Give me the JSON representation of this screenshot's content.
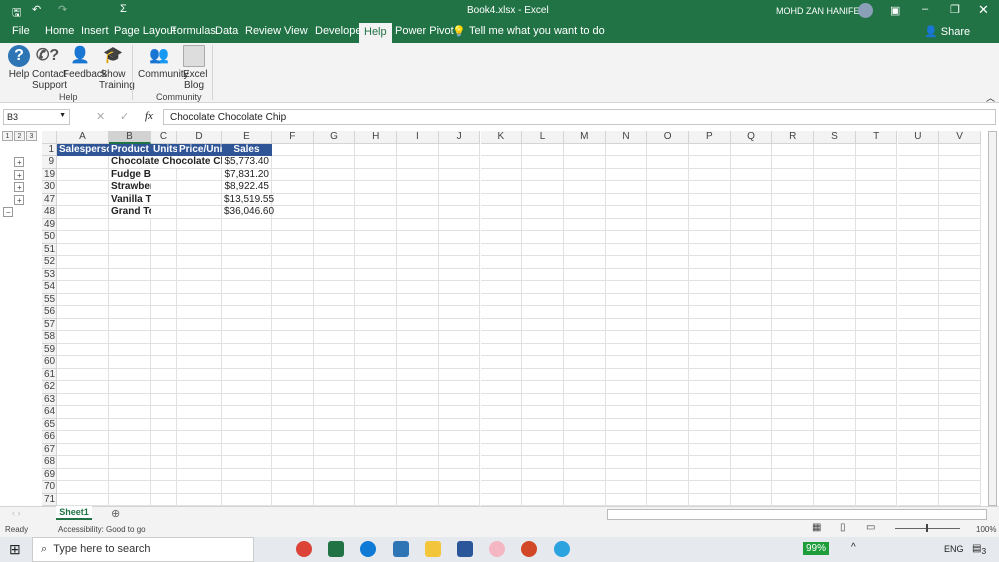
{
  "title_bar": {
    "title": "Book4.xlsx  -  Excel",
    "user": "MOHD ZAN HANIFEE"
  },
  "tabs": [
    "File",
    "Home",
    "Insert",
    "Page Layout",
    "Formulas",
    "Data",
    "Review",
    "View",
    "Developer",
    "Help",
    "Power Pivot"
  ],
  "active_tab": "Help",
  "tell_me": "Tell me what you want to do",
  "share": "Share",
  "ribbon": {
    "buttons": [
      {
        "l1": "Help",
        "l2": ""
      },
      {
        "l1": "Contact",
        "l2": "Support"
      },
      {
        "l1": "Feedback",
        "l2": ""
      },
      {
        "l1": "Show",
        "l2": "Training"
      },
      {
        "l1": "Community",
        "l2": ""
      },
      {
        "l1": "Excel",
        "l2": "Blog"
      }
    ],
    "groups": [
      "Help",
      "Community"
    ]
  },
  "formula_bar": {
    "name_box": "B3",
    "fx": "fx",
    "formula": "Chocolate Chocolate Chip"
  },
  "outline_levels": [
    "1",
    "2",
    "3"
  ],
  "columns": [
    "A",
    "B",
    "C",
    "D",
    "E",
    "F",
    "G",
    "H",
    "I",
    "J",
    "K",
    "L",
    "M",
    "N",
    "O",
    "P",
    "Q",
    "R",
    "S",
    "T",
    "U",
    "V"
  ],
  "rows": [
    "1",
    "9",
    "19",
    "30",
    "47",
    "48",
    "49",
    "50",
    "51",
    "52",
    "53",
    "54",
    "55",
    "56",
    "57",
    "58",
    "59",
    "60",
    "61",
    "62",
    "63",
    "64",
    "65",
    "66",
    "67",
    "68",
    "69",
    "70",
    "71"
  ],
  "header_row": [
    "Salesperson",
    "Product",
    "Units",
    "Price/Unit",
    "Sales"
  ],
  "data_rows": [
    {
      "product": "Chocolate Chocolate Chip Total",
      "sales": "$5,773.40"
    },
    {
      "product": "Fudge Brownie Total",
      "sales": "$7,831.20"
    },
    {
      "product": "Strawberry Total",
      "sales": "$8,922.45"
    },
    {
      "product": "Vanilla Total",
      "sales": "$13,519.55"
    },
    {
      "product": "Grand Total",
      "sales": "$36,046.60"
    }
  ],
  "sheet_tab": "Sheet1",
  "status": {
    "ready": "Ready",
    "accessibility": "Accessibility: Good to go",
    "zoom": "100%"
  },
  "taskbar": {
    "search": "Type here to search",
    "battery": "99%",
    "lang": "ENG",
    "notif": "3"
  }
}
